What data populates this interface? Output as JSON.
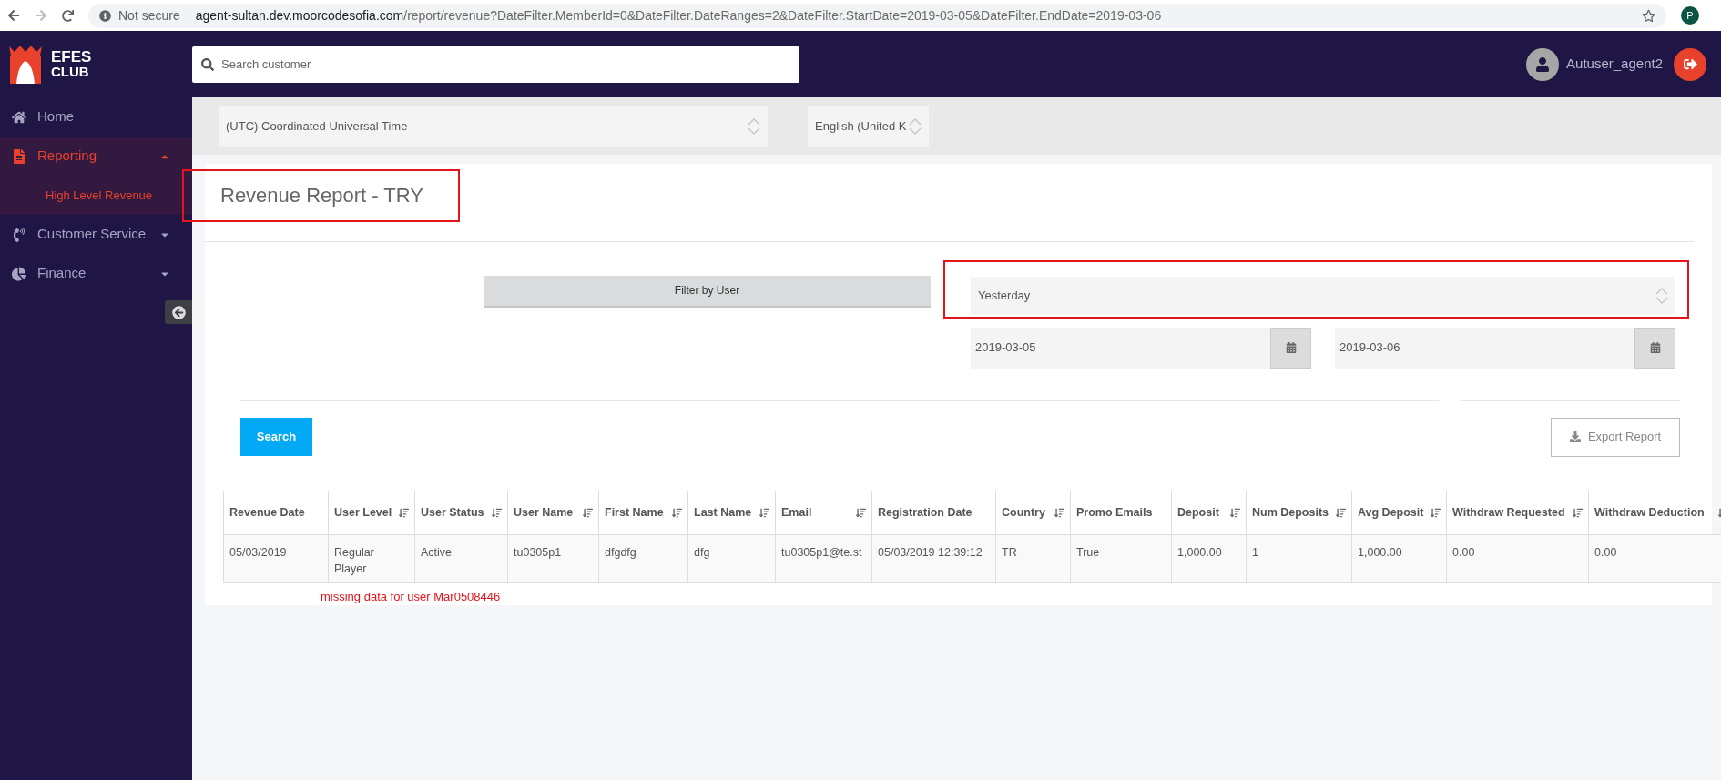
{
  "browser": {
    "security": "Not secure",
    "url_host": "agent-sultan.dev.moorcodesofia.com",
    "url_path": "/report/revenue?DateFilter.MemberId=0&DateFilter.DateRanges=2&DateFilter.StartDate=2019-03-05&DateFilter.EndDate=2019-03-06",
    "profile_initial": "P"
  },
  "header": {
    "logo_top": "EFES",
    "logo_bottom": "CLUB",
    "search_placeholder": "Search customer",
    "username": "Autuser_agent2"
  },
  "sidebar": {
    "items": [
      {
        "kind": "home",
        "label": "Home",
        "selected": false
      },
      {
        "kind": "report",
        "label": "Reporting",
        "selected": true,
        "expanded": true,
        "children": [
          {
            "label": "High Level Revenue",
            "selected": true
          }
        ]
      },
      {
        "kind": "phone",
        "label": "Customer Service",
        "selected": false,
        "expanded": false
      },
      {
        "kind": "pie",
        "label": "Finance",
        "selected": false,
        "expanded": false
      }
    ]
  },
  "settings": {
    "timezone": "(UTC) Coordinated Universal Time",
    "language": "English (United K"
  },
  "report": {
    "title": "Revenue Report - TRY",
    "filter_button": "Filter by User",
    "date_range": "Yesterday",
    "start_date": "2019-03-05",
    "end_date": "2019-03-06",
    "search_button": "Search",
    "export_button": "Export Report"
  },
  "table": {
    "columns": [
      {
        "label": "Revenue Date",
        "sortable": false
      },
      {
        "label": "User Level",
        "sortable": true
      },
      {
        "label": "User Status",
        "sortable": true
      },
      {
        "label": "User Name",
        "sortable": true
      },
      {
        "label": "First Name",
        "sortable": true
      },
      {
        "label": "Last Name",
        "sortable": true
      },
      {
        "label": "Email",
        "sortable": true
      },
      {
        "label": "Registration Date",
        "sortable": false
      },
      {
        "label": "Country",
        "sortable": true
      },
      {
        "label": "Promo Emails",
        "sortable": false
      },
      {
        "label": "Deposit",
        "sortable": true
      },
      {
        "label": "Num Deposits",
        "sortable": true
      },
      {
        "label": "Avg Deposit",
        "sortable": true
      },
      {
        "label": "Withdraw Requested",
        "sortable": true
      },
      {
        "label": "Withdraw Deduction",
        "sortable": true
      }
    ],
    "rows": [
      [
        "05/03/2019",
        "Regular Player",
        "Active",
        "tu0305p1",
        "dfgdfg",
        "dfg",
        "tu0305p1@te.st",
        "05/03/2019 12:39:12",
        "TR",
        "True",
        "1,000.00",
        "1",
        "1,000.00",
        "0.00",
        "0.00"
      ]
    ]
  },
  "annotations": {
    "note": "missing data for user Mar0508446"
  }
}
